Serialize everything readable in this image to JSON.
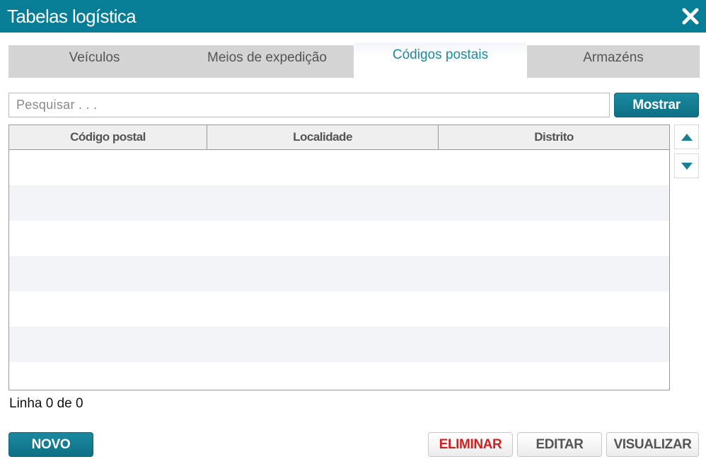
{
  "window": {
    "title": "Tabelas logística",
    "close_icon": "close-icon"
  },
  "tabs": [
    {
      "label": "Veículos",
      "active": false
    },
    {
      "label": "Meios de expedição",
      "active": false
    },
    {
      "label": "Códigos postais",
      "active": true
    },
    {
      "label": "Armazéns",
      "active": false
    }
  ],
  "search": {
    "placeholder": "Pesquisar . . .",
    "value": "",
    "button_label": "Mostrar"
  },
  "table": {
    "columns": [
      "Código postal",
      "Localidade",
      "Distrito"
    ],
    "rows": []
  },
  "scroll": {
    "up_icon": "triangle-up-icon",
    "down_icon": "triangle-down-icon"
  },
  "status": {
    "text": "Linha 0 de 0"
  },
  "actions": {
    "new_label": "NOVO",
    "delete_label": "ELIMINAR",
    "edit_label": "EDITAR",
    "view_label": "VISUALIZAR"
  },
  "colors": {
    "brand": "#077e95",
    "active_tab_text": "#1b8aa1",
    "danger": "#d31f1f"
  }
}
